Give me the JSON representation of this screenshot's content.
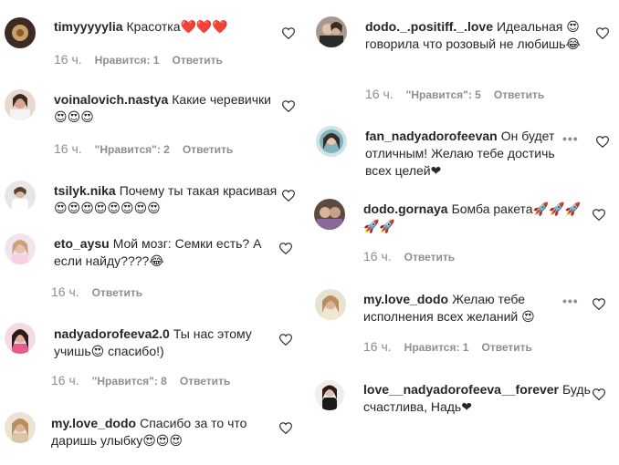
{
  "comments_left": [
    {
      "username": "timyyyyylia",
      "text": "Красотка❤️❤️❤️",
      "time": "16 ч.",
      "likes": "Нравится: 1",
      "reply": "Ответить"
    },
    {
      "username": "voinalovich.nastya",
      "text": "Какие черевички😍😍😍",
      "time": "16 ч.",
      "likes": "\"Нравится\": 2",
      "reply": "Ответить"
    },
    {
      "username": "tsilyk.nika",
      "text": "Почему ты такая красивая 😍😍😍😍😍😍😍😍",
      "time": "",
      "likes": "",
      "reply": ""
    },
    {
      "username": "eto_aysu",
      "text": "Мой мозг: Семки есть? А если найду????😂",
      "time": "16 ч.",
      "likes": "",
      "reply": "Ответить"
    },
    {
      "username": "nadyadorofeeva2.0",
      "text": "Ты нас этому учишь😍 спасибо!)",
      "time": "16 ч.",
      "likes": "\"Нравится\": 8",
      "reply": "Ответить"
    },
    {
      "username": "my.love_dodo",
      "text": "Спасибо за то что даришь улыбку😍😍😍",
      "time": "",
      "likes": "",
      "reply": ""
    }
  ],
  "comments_right": [
    {
      "username": "dodo._.positiff._.love",
      "text": "Идеальная 😍говорила что розовый не любишь😂",
      "time": "16 ч.",
      "likes": "\"Нравится\": 5",
      "reply": "Ответить"
    },
    {
      "username": "fan_nadyadorofeevan",
      "text": "Он будет отличным! Желаю тебе достичь всех целей❤",
      "time": "",
      "likes": "",
      "reply": ""
    },
    {
      "username": "dodo.gornaya",
      "text": "Бомба ракета🚀🚀🚀🚀🚀",
      "time": "16 ч.",
      "likes": "",
      "reply": "Ответить"
    },
    {
      "username": "my.love_dodo",
      "text": "Желаю тебе исполнения всех желаний 😍",
      "time": "16 ч.",
      "likes": "Нравится: 1",
      "reply": "Ответить"
    },
    {
      "username": "love__nadyadorofeeva__forever",
      "text": "Будь счастлива, Надь❤",
      "time": "",
      "likes": "",
      "reply": ""
    }
  ],
  "more_options_label": "•••",
  "icons": {
    "like": "heart-icon",
    "more": "more-options-icon"
  },
  "colors": {
    "text": "#262626",
    "meta": "#8e8e8e"
  }
}
